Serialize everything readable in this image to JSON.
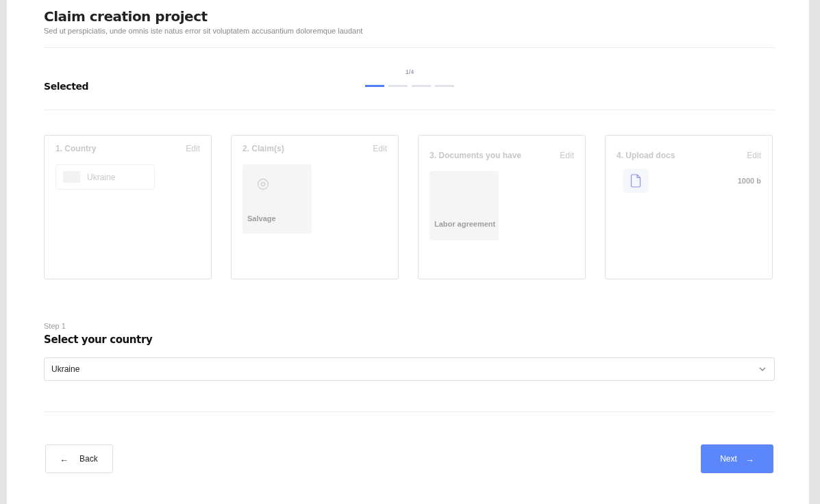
{
  "header": {
    "title": "Claim creation project",
    "subtitle": "Sed ut perspiciatis, unde omnis iste natus error sit voluptatem accusantium doloremque laudant"
  },
  "summary": {
    "heading": "Selected",
    "progress_label": "1/4",
    "steps": [
      {
        "selected": true
      },
      {
        "selected": false
      },
      {
        "selected": false
      },
      {
        "selected": false
      }
    ]
  },
  "cards": [
    {
      "kind": "country",
      "title": "1. Country",
      "action": "Edit",
      "value": "Ukraine"
    },
    {
      "kind": "claim",
      "title": "2. Claim(s)",
      "action": "Edit",
      "value": "Salvage"
    },
    {
      "kind": "document",
      "title": "3. Documents you have",
      "action": "Edit",
      "value": "Labor agreement"
    },
    {
      "kind": "upload",
      "title": "4. Upload docs",
      "action": "Edit",
      "value": "1000 b"
    }
  ],
  "step": {
    "label": "Step 1",
    "heading": "Select your country",
    "select_value": "Ukraine"
  },
  "footer": {
    "back": {
      "icon": "←",
      "label": "Back"
    },
    "next": {
      "label": "Next",
      "icon": "→"
    }
  }
}
